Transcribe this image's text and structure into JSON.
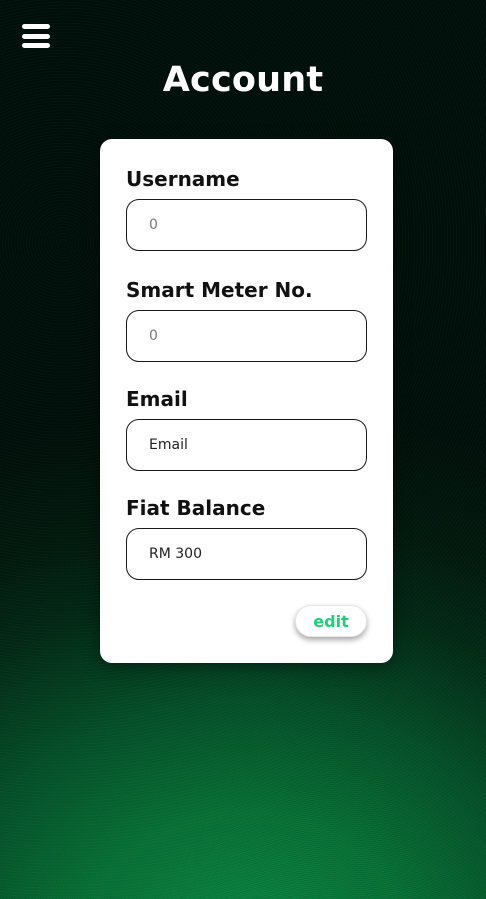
{
  "header": {
    "menu_icon": "hamburger-menu-icon",
    "title": "Account"
  },
  "form": {
    "fields": [
      {
        "label": "Username",
        "value": "",
        "placeholder": "0"
      },
      {
        "label": "Smart Meter No.",
        "value": "",
        "placeholder": "0"
      },
      {
        "label": "Email",
        "value": "Email",
        "placeholder": ""
      },
      {
        "label": "Fiat Balance",
        "value": "RM 300",
        "placeholder": ""
      }
    ],
    "edit_label": "edit"
  },
  "colors": {
    "accent": "#1fd07a",
    "background_dark": "#01100a",
    "background_green": "#0c8a45",
    "card": "#ffffff"
  }
}
